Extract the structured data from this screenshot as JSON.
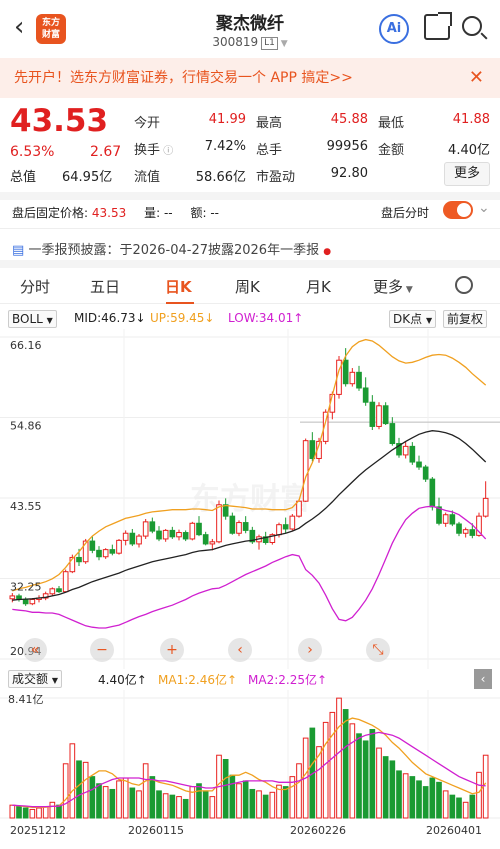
{
  "header": {
    "back_icon": "chevron-left-icon",
    "logo_line1": "东方",
    "logo_line2": "财富",
    "title": "聚杰微纤",
    "code": "300819",
    "level": "L1",
    "ai_label": "Ai"
  },
  "banner": {
    "text": "先开户！选东方财富证券，行情交易一个 APP 搞定>>",
    "close": "✕"
  },
  "quote": {
    "price": "43.53",
    "change_pct": "6.53%",
    "change": "2.67",
    "rows": [
      [
        {
          "label": "今开",
          "value": "41.99",
          "color": "#e02020"
        },
        {
          "label": "最高",
          "value": "45.88",
          "color": "#e02020"
        },
        {
          "label": "最低",
          "value": "41.88",
          "color": "#e02020"
        }
      ],
      [
        {
          "label": "换手",
          "value": "7.42%",
          "color": "#222"
        },
        {
          "label": "总手",
          "value": "99956",
          "color": "#222"
        },
        {
          "label": "金额",
          "value": "4.40亿",
          "color": "#222"
        }
      ],
      [
        {
          "label": "总值",
          "value": "64.95亿",
          "color": "#222"
        },
        {
          "label": "流值",
          "value": "58.66亿",
          "color": "#222"
        },
        {
          "label": "市盈动",
          "value": "92.80",
          "color": "#222"
        }
      ]
    ],
    "more": "更多"
  },
  "afterhours": {
    "fixed_label": "盘后固定价格:",
    "fixed_price": "43.53",
    "vol_label": "量:",
    "vol": "--",
    "amt_label": "额:",
    "amt": "--",
    "toggle_label": "盘后分时"
  },
  "notice": {
    "text": "一季报预披露：于2026-04-27披露2026年一季报"
  },
  "tabs": [
    "分时",
    "五日",
    "日K",
    "周K",
    "月K",
    "更多"
  ],
  "active_tab": "日K",
  "chart_controls": {
    "indicator": "BOLL",
    "mid": "MID:46.73↓",
    "up": "UP:59.45↓",
    "low": "LOW:34.01↑",
    "dk": "DK点",
    "adjust": "前复权"
  },
  "watermark": "东方财富",
  "chart_data": {
    "type": "candlestick",
    "yticks": [
      "66.16",
      "54.86",
      "43.55",
      "32.25",
      "20.94"
    ],
    "xlabels": [
      "20251212",
      "20260115",
      "20260226",
      "20260401"
    ],
    "nav_buttons": [
      "«",
      "−",
      "+",
      "‹",
      "›",
      "⤡"
    ],
    "volume_panel": {
      "label": "成交额",
      "value": "4.40亿↑",
      "ma1": "MA1:2.46亿↑",
      "ma2": "MA2:2.25亿↑",
      "max_label": "8.41亿"
    },
    "candles": [
      [
        29.4,
        30.2,
        28.9,
        29.8
      ],
      [
        29.8,
        30.1,
        29.0,
        29.3
      ],
      [
        29.3,
        29.6,
        28.4,
        28.7
      ],
      [
        28.7,
        29.5,
        28.5,
        29.3
      ],
      [
        29.3,
        29.9,
        28.9,
        29.5
      ],
      [
        29.5,
        30.4,
        29.2,
        30.1
      ],
      [
        30.1,
        31.0,
        29.8,
        30.8
      ],
      [
        30.8,
        31.2,
        30.2,
        30.4
      ],
      [
        30.4,
        33.5,
        30.3,
        33.2
      ],
      [
        33.2,
        35.6,
        33.0,
        35.2
      ],
      [
        35.2,
        36.4,
        34.0,
        34.6
      ],
      [
        34.6,
        37.8,
        34.3,
        37.5
      ],
      [
        37.5,
        38.2,
        35.8,
        36.2
      ],
      [
        36.2,
        36.8,
        34.8,
        35.3
      ],
      [
        35.3,
        36.5,
        35.0,
        36.3
      ],
      [
        36.3,
        37.0,
        35.5,
        35.8
      ],
      [
        35.8,
        37.8,
        35.6,
        37.6
      ],
      [
        37.6,
        39.0,
        36.9,
        38.6
      ],
      [
        38.6,
        39.2,
        36.8,
        37.1
      ],
      [
        37.1,
        38.5,
        36.6,
        38.2
      ],
      [
        38.2,
        40.6,
        37.8,
        40.2
      ],
      [
        40.2,
        40.8,
        38.6,
        38.9
      ],
      [
        38.9,
        39.6,
        37.5,
        37.8
      ],
      [
        37.8,
        39.2,
        37.4,
        39.0
      ],
      [
        39.0,
        39.5,
        37.8,
        38.1
      ],
      [
        38.1,
        39.1,
        37.6,
        38.7
      ],
      [
        38.7,
        39.0,
        37.5,
        37.8
      ],
      [
        37.8,
        40.2,
        37.6,
        40.0
      ],
      [
        40.0,
        41.0,
        38.2,
        38.4
      ],
      [
        38.4,
        38.8,
        36.9,
        37.1
      ],
      [
        37.1,
        37.8,
        36.2,
        37.4
      ],
      [
        37.4,
        43.2,
        37.2,
        42.6
      ],
      [
        42.6,
        43.5,
        40.5,
        41.0
      ],
      [
        41.0,
        41.5,
        38.4,
        38.6
      ],
      [
        38.6,
        40.4,
        38.2,
        40.1
      ],
      [
        40.1,
        41.0,
        38.6,
        39.0
      ],
      [
        39.0,
        39.5,
        37.1,
        37.4
      ],
      [
        37.4,
        38.4,
        36.3,
        38.1
      ],
      [
        38.1,
        38.8,
        37.0,
        37.3
      ],
      [
        37.3,
        38.6,
        37.0,
        38.4
      ],
      [
        38.4,
        40.1,
        38.0,
        39.8
      ],
      [
        39.8,
        40.8,
        38.6,
        39.2
      ],
      [
        39.2,
        41.3,
        39.0,
        41.0
      ],
      [
        41.0,
        43.4,
        40.8,
        43.1
      ],
      [
        43.1,
        51.9,
        43.0,
        51.6
      ],
      [
        51.6,
        52.8,
        48.7,
        49.1
      ],
      [
        49.1,
        52.0,
        48.5,
        51.5
      ],
      [
        51.5,
        56.0,
        51.1,
        55.6
      ],
      [
        55.6,
        58.5,
        54.6,
        58.1
      ],
      [
        58.1,
        63.5,
        57.5,
        62.9
      ],
      [
        62.9,
        64.6,
        59.2,
        59.6
      ],
      [
        59.6,
        61.8,
        59.2,
        61.2
      ],
      [
        61.2,
        62.1,
        58.6,
        59.0
      ],
      [
        59.0,
        60.5,
        56.5,
        57.0
      ],
      [
        57.0,
        58.0,
        53.1,
        53.6
      ],
      [
        53.6,
        57.0,
        53.2,
        56.5
      ],
      [
        56.5,
        57.0,
        53.8,
        54.0
      ],
      [
        54.0,
        54.9,
        50.9,
        51.2
      ],
      [
        51.2,
        52.0,
        49.2,
        49.6
      ],
      [
        49.6,
        51.5,
        49.1,
        50.8
      ],
      [
        50.8,
        51.4,
        48.2,
        48.6
      ],
      [
        48.6,
        49.5,
        47.5,
        47.9
      ],
      [
        47.9,
        48.2,
        45.8,
        46.2
      ],
      [
        46.2,
        46.5,
        41.8,
        42.3
      ],
      [
        42.3,
        43.6,
        39.7,
        40.0
      ],
      [
        40.0,
        41.5,
        39.5,
        41.2
      ],
      [
        41.2,
        41.8,
        39.6,
        39.9
      ],
      [
        39.9,
        40.2,
        38.2,
        38.6
      ],
      [
        38.6,
        39.4,
        38.0,
        39.1
      ],
      [
        39.1,
        40.0,
        37.9,
        38.3
      ],
      [
        38.3,
        41.5,
        38.1,
        41.0
      ],
      [
        41.0,
        45.9,
        40.8,
        43.5
      ]
    ],
    "mid": [
      29.2,
      29.3,
      29.35,
      29.4,
      29.5,
      29.6,
      29.8,
      30.0,
      30.3,
      30.7,
      31.0,
      31.4,
      31.8,
      32.1,
      32.4,
      32.7,
      33.0,
      33.4,
      33.7,
      34.0,
      34.3,
      34.6,
      34.8,
      35.0,
      35.2,
      35.4,
      35.6,
      35.9,
      36.1,
      36.2,
      36.3,
      36.6,
      36.9,
      37.1,
      37.3,
      37.5,
      37.6,
      37.8,
      38.0,
      38.2,
      38.4,
      38.6,
      38.9,
      39.3,
      40.0,
      40.6,
      41.3,
      42.1,
      43.0,
      44.0,
      44.9,
      45.8,
      46.7,
      47.5,
      48.2,
      48.9,
      49.6,
      50.3,
      50.9,
      51.5,
      52.0,
      52.5,
      52.8,
      53.0,
      52.9,
      52.7,
      52.4,
      51.9,
      51.2,
      50.4,
      49.5,
      48.6
    ],
    "up": [
      30.5,
      30.8,
      31.0,
      31.3,
      31.5,
      31.8,
      32.2,
      32.8,
      33.8,
      35.0,
      36.0,
      37.2,
      38.2,
      38.9,
      39.5,
      39.9,
      40.3,
      40.7,
      40.9,
      41.1,
      41.4,
      41.6,
      41.7,
      41.8,
      41.9,
      41.9,
      41.9,
      42.0,
      42.0,
      41.9,
      41.8,
      42.3,
      42.5,
      42.4,
      42.3,
      42.2,
      42.0,
      42.0,
      42.0,
      41.9,
      41.9,
      41.9,
      42.2,
      43.2,
      46.5,
      48.5,
      51.0,
      54.3,
      58.0,
      61.5,
      63.5,
      64.8,
      65.5,
      65.8,
      65.6,
      65.0,
      64.2,
      63.4,
      62.8,
      62.5,
      62.6,
      62.9,
      63.3,
      63.6,
      63.7,
      63.6,
      63.2,
      62.6,
      61.9,
      61.0,
      60.2,
      59.4
    ],
    "low": [
      27.9,
      27.8,
      27.7,
      27.5,
      27.5,
      27.4,
      27.4,
      27.2,
      26.8,
      26.4,
      26.0,
      25.6,
      25.4,
      25.3,
      25.3,
      25.5,
      25.7,
      26.1,
      26.5,
      26.9,
      27.2,
      27.6,
      27.9,
      28.2,
      28.5,
      28.9,
      29.3,
      29.8,
      30.2,
      30.5,
      30.8,
      30.9,
      31.3,
      31.8,
      32.3,
      32.8,
      33.2,
      33.6,
      34.0,
      34.5,
      34.9,
      35.3,
      35.6,
      35.4,
      33.5,
      32.7,
      31.6,
      29.9,
      28.0,
      26.5,
      26.3,
      26.8,
      27.9,
      29.2,
      30.8,
      32.8,
      35.0,
      37.2,
      39.0,
      40.5,
      41.4,
      42.1,
      42.3,
      42.4,
      42.1,
      41.8,
      41.6,
      41.2,
      40.5,
      39.8,
      38.8,
      37.8
    ],
    "resistance_level": 54.2,
    "volume_yi": [
      0.9,
      0.8,
      0.7,
      0.6,
      0.7,
      0.8,
      1.1,
      0.9,
      3.8,
      5.2,
      4.0,
      3.9,
      2.9,
      2.4,
      2.2,
      2.0,
      2.6,
      2.8,
      2.1,
      1.9,
      3.8,
      2.9,
      1.9,
      1.7,
      1.6,
      1.5,
      1.3,
      2.2,
      2.4,
      1.9,
      1.5,
      4.4,
      4.1,
      3.0,
      2.4,
      2.6,
      2.0,
      1.9,
      1.6,
      1.8,
      2.3,
      2.2,
      2.9,
      3.8,
      5.6,
      6.3,
      5.0,
      6.7,
      7.4,
      8.4,
      7.6,
      6.6,
      5.9,
      5.4,
      6.2,
      4.9,
      4.3,
      4.0,
      3.3,
      3.1,
      2.9,
      2.6,
      2.2,
      2.8,
      2.5,
      1.9,
      1.6,
      1.4,
      1.1,
      1.6,
      3.2,
      4.4
    ],
    "vol_ma1": [
      0.9,
      0.85,
      0.8,
      0.75,
      0.74,
      0.76,
      0.82,
      0.85,
      1.3,
      1.9,
      2.3,
      2.7,
      3.0,
      3.3,
      3.3,
      3.1,
      2.7,
      2.6,
      2.4,
      2.3,
      2.6,
      2.7,
      2.5,
      2.4,
      2.3,
      2.1,
      1.9,
      1.8,
      1.9,
      1.9,
      1.9,
      2.4,
      2.8,
      3.0,
      3.0,
      3.2,
      3.0,
      2.7,
      2.5,
      2.2,
      2.0,
      2.0,
      2.2,
      2.5,
      3.1,
      3.8,
      4.4,
      5.2,
      5.8,
      6.4,
      6.8,
      7.0,
      6.9,
      6.7,
      6.5,
      6.2,
      5.8,
      5.3,
      4.9,
      4.4,
      3.9,
      3.5,
      3.1,
      2.9,
      2.7,
      2.5,
      2.3,
      2.1,
      1.9,
      1.7,
      1.8,
      2.46
    ],
    "vol_ma2": [
      0.9,
      0.87,
      0.84,
      0.8,
      0.79,
      0.8,
      0.82,
      0.83,
      1.0,
      1.3,
      1.6,
      1.8,
      2.0,
      2.3,
      2.5,
      2.7,
      2.8,
      2.8,
      2.8,
      2.8,
      2.7,
      2.7,
      2.6,
      2.6,
      2.5,
      2.4,
      2.3,
      2.2,
      2.2,
      2.1,
      2.1,
      2.2,
      2.3,
      2.4,
      2.5,
      2.6,
      2.6,
      2.6,
      2.6,
      2.6,
      2.5,
      2.5,
      2.5,
      2.6,
      2.8,
      3.1,
      3.4,
      3.8,
      4.2,
      4.6,
      5.0,
      5.3,
      5.6,
      5.8,
      5.9,
      6.0,
      5.9,
      5.8,
      5.6,
      5.3,
      5.0,
      4.7,
      4.4,
      4.1,
      3.8,
      3.5,
      3.2,
      2.9,
      2.7,
      2.5,
      2.3,
      2.25
    ]
  }
}
